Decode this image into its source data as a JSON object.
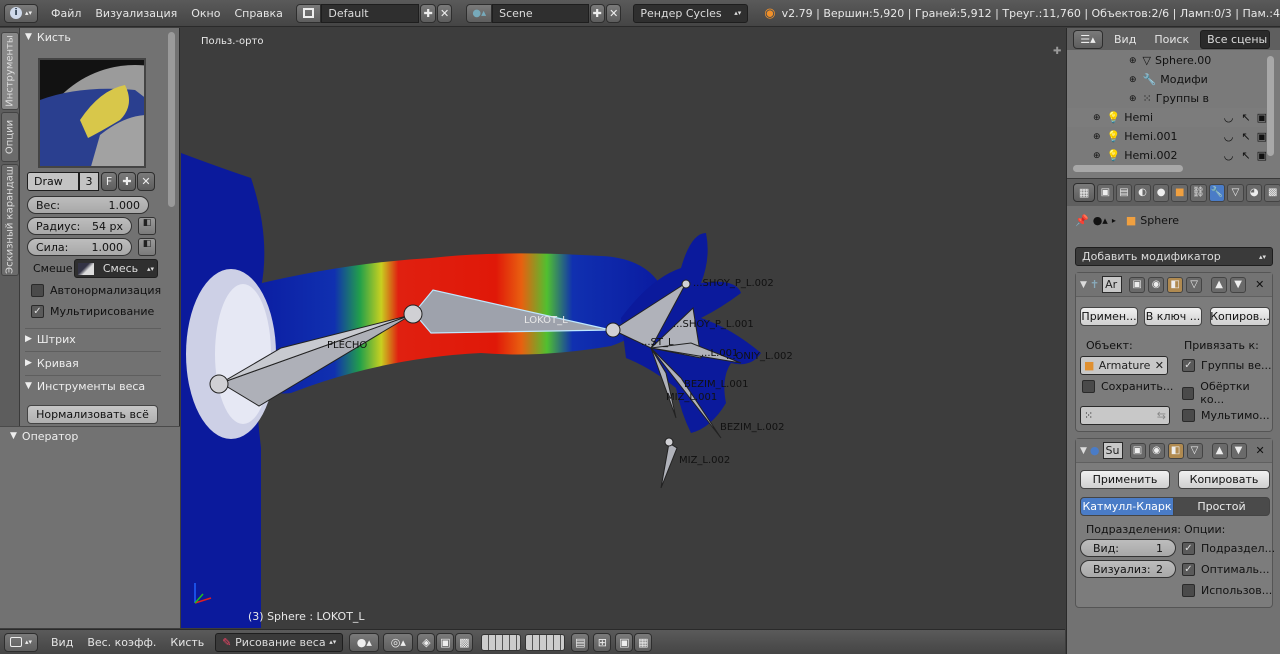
{
  "topbar": {
    "menus": [
      "Файл",
      "Визуализация",
      "Окно",
      "Справка"
    ],
    "layout_name": "Default",
    "scene_name": "Scene",
    "render_engine": "Рендер Cycles",
    "stats": "v2.79 | Вершин:5,920 | Граней:5,912 | Треуг.:11,760 | Объектов:2/6 | Ламп:0/3 | Пам.:4"
  },
  "tool_tabs": [
    "Инструменты",
    "Опции",
    "Эскизный карандаш"
  ],
  "brush": {
    "header": "Кисть",
    "name": "Draw",
    "users": "3",
    "fake_user": "F",
    "weight_label": "Вес:",
    "weight_value": "1.000",
    "radius_label": "Радиус:",
    "radius_value": "54 px",
    "strength_label": "Сила:",
    "strength_value": "1.000",
    "blend_label": "Смеше",
    "blend_value": "Смесь",
    "auto_normalize": "Автонормализация",
    "multipaint": "Мультирисование"
  },
  "collapsed_sections": [
    "Штрих",
    "Кривая"
  ],
  "weight_tools": {
    "header": "Инструменты веса",
    "normalize_all": "Нормализовать всё"
  },
  "operator_header": "Оператор",
  "viewport": {
    "view_label": "Польз.-орто",
    "active_object": "(3) Sphere : LOKOT_L",
    "bone_labels": [
      "PLECHO",
      "LOKOT_L",
      "...SHOY_P_L.002",
      "...SHOY_P_L.001",
      "...ST_L",
      "...ONIY_L.002",
      "...L.001",
      "BEZIM_L.001",
      "MIZ_L.001",
      "BEZIM_L.002",
      "MIZ_L.002"
    ]
  },
  "bottombar": {
    "menus": [
      "Вид",
      "Вес. коэфф.",
      "Кисть"
    ],
    "mode": "Рисование веса"
  },
  "outliner": {
    "menus": [
      "Вид",
      "Поиск"
    ],
    "filter": "Все сцены",
    "rows": [
      "Sphere.00",
      "Модифи",
      "Группы в",
      "Hemi",
      "Hemi.001",
      "Hemi.002"
    ]
  },
  "properties": {
    "object_name": "Sphere",
    "add_modifier": "Добавить модификатор",
    "armature_mod": {
      "short_name": "Ar",
      "apply": "Примен...",
      "to_key": "В ключ ...",
      "copy": "Копиров...",
      "object_label": "Объект:",
      "object_value": "Armature",
      "bind_to_label": "Привязать к:",
      "vertex_groups": "Группы ве...",
      "envelopes": "Обёртки ко...",
      "preserve": "Сохранить...",
      "multi": "Мультимо..."
    },
    "subsurf_mod": {
      "short_name": "Su",
      "apply": "Применить",
      "copy": "Копировать",
      "catmull": "Катмулл-Кларк",
      "simple": "Простой",
      "subdivisions_label": "Подразделения:",
      "options_label": "Опции:",
      "view_label": "Вид:",
      "view_value": "1",
      "render_label": "Визуализ:",
      "render_value": "2",
      "opt_subdiv_uv": "Подраздел...",
      "opt_optimal": "Оптималь...",
      "opt_use": "Использов..."
    }
  }
}
